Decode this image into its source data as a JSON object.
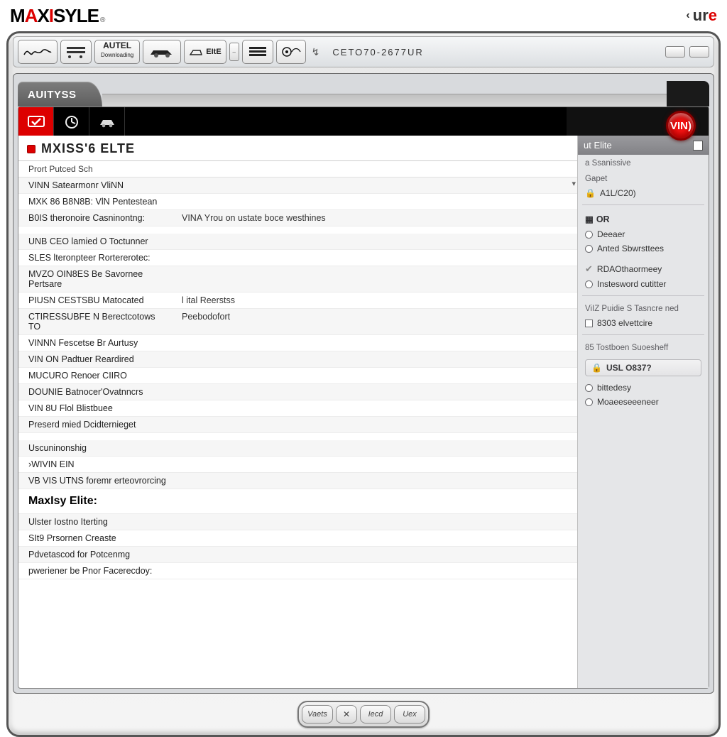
{
  "brand": {
    "pre": "M",
    "red1": "A",
    "mid": "X",
    "red2": "I",
    "post": "SYLE",
    "reg": "®"
  },
  "brand_right": {
    "chev": "‹",
    "text": "ur",
    "accent": "e"
  },
  "toolbar": {
    "items": [
      {
        "name": "signature-icon",
        "label": ""
      },
      {
        "name": "vehicle-list-icon",
        "label": ""
      },
      {
        "name": "autel-button",
        "label1": "AUTEL",
        "label2": "Downloading"
      },
      {
        "name": "car-icon",
        "label": ""
      },
      {
        "name": "elite-button",
        "label": "EItE"
      },
      {
        "name": "stack-icon",
        "label": ""
      },
      {
        "name": "wheel-icon",
        "label": ""
      }
    ],
    "status_text": "CETO70-2677UR",
    "tiny_toggle": "–"
  },
  "tab": {
    "active": "AUITYSS"
  },
  "icon_tabs": [
    "scan-icon",
    "timer-icon",
    "car-in-icon"
  ],
  "vin_badge": "VIN)",
  "header": {
    "title": "MXISS'6 ELTE",
    "subtitle": "Prort Putced Sch"
  },
  "rows": [
    {
      "type": "row",
      "c1": "VINN Satearmonr VliNN",
      "c2": ""
    },
    {
      "type": "row",
      "c1": "MXK 86 B8N8B: VlN Pentestean",
      "c2": ""
    },
    {
      "type": "row",
      "c1": "B0IS theronoire Casninontng:",
      "c2": "VINA Yrou on ustate boce westhines"
    },
    {
      "type": "spacer"
    },
    {
      "type": "row",
      "c1": "UNB CEO lamied O Toctunner",
      "c2": ""
    },
    {
      "type": "row",
      "c1": "SLES lteronpteer Rortererotec:",
      "c2": ""
    },
    {
      "type": "row",
      "c1": "MVZO OIN8ES Be Savornee Pertsare",
      "c2": ""
    },
    {
      "type": "row",
      "c1": "PIUSN CESTSBU Matocated",
      "c2": "l ital Reerstss"
    },
    {
      "type": "row",
      "c1": "CTIRESSUBFE N Berectcotows TO",
      "c2": "Peebodofort"
    },
    {
      "type": "row",
      "c1": "VINNN Fescetse Br Aurtusy",
      "c2": ""
    },
    {
      "type": "row",
      "c1": "VIN ON Padtuer Reardired",
      "c2": ""
    },
    {
      "type": "row",
      "c1": "MUCURO Renoer CIIRO",
      "c2": ""
    },
    {
      "type": "row",
      "c1": "DOUNIE Batnocer'Ovatnncrs",
      "c2": ""
    },
    {
      "type": "row",
      "c1": "VIN 8U Flol Blistbuee",
      "c2": ""
    },
    {
      "type": "row",
      "c1": "Preserd  mied Dcidternieget",
      "c2": ""
    },
    {
      "type": "spacer"
    },
    {
      "type": "row",
      "c1": "Uscuninonshig",
      "c2": ""
    },
    {
      "type": "row",
      "c1": "›WIVIN  EIN",
      "c2": ""
    },
    {
      "type": "row",
      "c1": "VB VIS UTNS foremr erteovrorcing",
      "c2": ""
    },
    {
      "type": "section",
      "c1": "MaxIsy Elite:",
      "c2": ""
    },
    {
      "type": "row",
      "c1": "Ulster  Iostno Iterting",
      "c2": ""
    },
    {
      "type": "row",
      "c1": "SIt9 Prsornen Creaste",
      "c2": ""
    },
    {
      "type": "row",
      "c1": "Pdvetascod for Potcenmg",
      "c2": ""
    },
    {
      "type": "row",
      "c1": "pweriener be Pnor Facerecdoy:",
      "c2": ""
    }
  ],
  "sidebar": {
    "title": "ut Elite",
    "sub": "a Ssanissive",
    "gapet": "Gapet",
    "date": "A1L/C20)",
    "or_label": "OR",
    "radio1": "Deeaer",
    "radio2": "Anted Sbwrsttees",
    "chk1": "RDAOthaormeey",
    "chk2": "Instesword cutitter",
    "mid_label": "ViIZ Puidie  S Tasncre  ned",
    "chk3": "8303 elvettcire",
    "sub2": "85 Tostboen Suoesheff",
    "badge": "USL O837?",
    "radio3": "bittedesy",
    "radio4": "Moaeeseeeneer"
  },
  "hw": {
    "b1": "Vaets",
    "b2": "✕",
    "b3": "Iecd",
    "b4": "Uex"
  }
}
